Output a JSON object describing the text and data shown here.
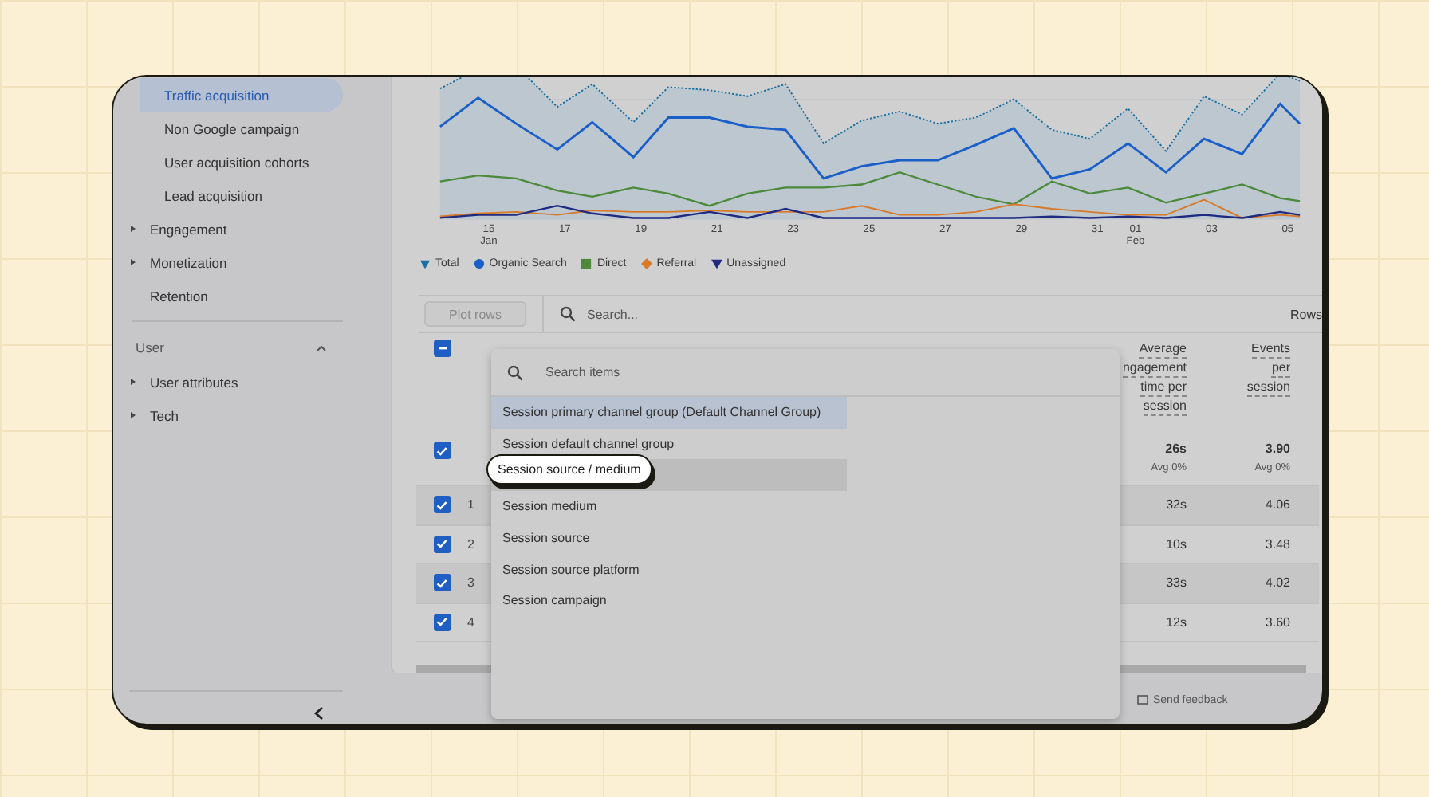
{
  "sidebar": {
    "items": [
      {
        "label": "Traffic acquisition",
        "kind": "sub",
        "selected": true
      },
      {
        "label": "Non Google campaign",
        "kind": "sub",
        "selected": false
      },
      {
        "label": "User acquisition cohorts",
        "kind": "sub",
        "selected": false
      },
      {
        "label": "Lead acquisition",
        "kind": "sub",
        "selected": false
      },
      {
        "label": "Engagement",
        "kind": "group",
        "selected": false
      },
      {
        "label": "Monetization",
        "kind": "group",
        "selected": false
      },
      {
        "label": "Retention",
        "kind": "leaf",
        "selected": false
      }
    ],
    "section": {
      "label": "User",
      "expanded": true
    },
    "section_items": [
      {
        "label": "User attributes",
        "kind": "group",
        "selected": false
      },
      {
        "label": "Tech",
        "kind": "group",
        "selected": false
      }
    ]
  },
  "chart": {
    "x_labels": [
      {
        "day": "15",
        "month": "Jan"
      },
      {
        "day": "17"
      },
      {
        "day": "19"
      },
      {
        "day": "21"
      },
      {
        "day": "23"
      },
      {
        "day": "25"
      },
      {
        "day": "27"
      },
      {
        "day": "29"
      },
      {
        "day": "31"
      },
      {
        "day": "01",
        "month": "Feb"
      },
      {
        "day": "03"
      },
      {
        "day": "05"
      }
    ],
    "legend": [
      {
        "label": "Total",
        "kind": "drop",
        "color": "#1a6fa0"
      },
      {
        "label": "Organic Search",
        "kind": "circle",
        "color": "#1a5fc8"
      },
      {
        "label": "Direct",
        "kind": "square",
        "color": "#4a8a3a"
      },
      {
        "label": "Referral",
        "kind": "diamond",
        "color": "#d9792a"
      },
      {
        "label": "Unassigned",
        "kind": "triangle",
        "color": "#1f2a80"
      }
    ]
  },
  "toolbar": {
    "plot_button": "Plot rows",
    "search_placeholder": "Search...",
    "rows_label": "Rows"
  },
  "table": {
    "header_indeterminate": true,
    "columns": [
      {
        "lines": [
          "Average",
          "ngagement",
          "time per",
          "session"
        ]
      },
      {
        "lines": [
          "Events",
          "per",
          "session"
        ]
      }
    ],
    "totals": {
      "checked": true,
      "values": [
        {
          "value": "26s",
          "note": "Avg 0%"
        },
        {
          "value": "3.90",
          "note": "Avg 0%"
        }
      ]
    },
    "rows": [
      {
        "index": "1",
        "checked": true,
        "values": [
          "32s",
          "4.06"
        ]
      },
      {
        "index": "2",
        "checked": true,
        "values": [
          "10s",
          "3.48"
        ]
      },
      {
        "index": "3",
        "checked": true,
        "values": [
          "33s",
          "4.02"
        ]
      },
      {
        "index": "4",
        "checked": true,
        "values": [
          "12s",
          "3.60"
        ]
      }
    ]
  },
  "dropdown": {
    "placeholder": "Search items",
    "items": [
      {
        "label": "Session primary channel group (Default Channel Group)",
        "selected": true,
        "hovered": false,
        "callout": false
      },
      {
        "label": "Session default channel group",
        "selected": false,
        "hovered": false,
        "callout": false
      },
      {
        "label": "Session source / medium",
        "selected": false,
        "hovered": true,
        "callout": true
      },
      {
        "label": "Session medium",
        "selected": false,
        "hovered": false,
        "callout": false
      },
      {
        "label": "Session source",
        "selected": false,
        "hovered": false,
        "callout": false
      },
      {
        "label": "Session source platform",
        "selected": false,
        "hovered": false,
        "callout": false
      },
      {
        "label": "Session campaign",
        "selected": false,
        "hovered": false,
        "callout": false
      }
    ]
  },
  "footer": {
    "feedback": "Send feedback"
  }
}
